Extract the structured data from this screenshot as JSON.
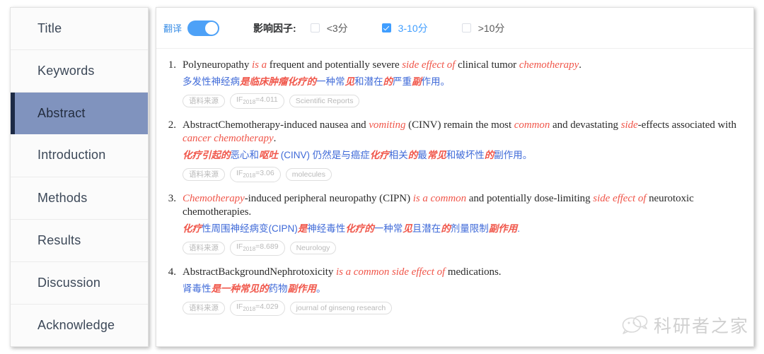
{
  "sidebar": {
    "items": [
      {
        "label": "Title",
        "active": false
      },
      {
        "label": "Keywords",
        "active": false
      },
      {
        "label": "Abstract",
        "active": true
      },
      {
        "label": "Introduction",
        "active": false
      },
      {
        "label": "Methods",
        "active": false
      },
      {
        "label": "Results",
        "active": false
      },
      {
        "label": "Discussion",
        "active": false
      },
      {
        "label": "Acknowledge",
        "active": false
      }
    ]
  },
  "toolbar": {
    "translate_label": "翻译",
    "translate_on": true,
    "impact_factor_label": "影响因子:",
    "filters": [
      {
        "label": "<3分",
        "checked": false
      },
      {
        "label": "3-10分",
        "checked": true
      },
      {
        "label": ">10分",
        "checked": false
      }
    ]
  },
  "results": [
    {
      "number": "1.",
      "en_parts": [
        {
          "t": "Polyneuropathy ",
          "hl": false
        },
        {
          "t": "is a",
          "hl": true
        },
        {
          "t": " frequent and potentially severe ",
          "hl": false
        },
        {
          "t": "side effect of",
          "hl": true
        },
        {
          "t": " clinical tumor ",
          "hl": false
        },
        {
          "t": "chemotherapy",
          "hl": true
        },
        {
          "t": ".",
          "hl": false
        }
      ],
      "cn_parts": [
        {
          "t": "多发性神经病",
          "hl": false
        },
        {
          "t": "是临床肿瘤化疗的",
          "hl": true
        },
        {
          "t": "一种常",
          "hl": false
        },
        {
          "t": "见",
          "hl": true
        },
        {
          "t": "和潜在",
          "hl": false
        },
        {
          "t": "的",
          "hl": true
        },
        {
          "t": "严重",
          "hl": false
        },
        {
          "t": "副",
          "hl": true
        },
        {
          "t": "作用",
          "hl": false
        },
        {
          "t": "。",
          "hl": false
        }
      ],
      "tags": [
        {
          "text": "语料来源"
        },
        {
          "text": "IF",
          "sub": "2018",
          "tail": "=4.011"
        },
        {
          "text": "Scientific Reports"
        }
      ]
    },
    {
      "number": "2.",
      "en_parts": [
        {
          "t": "AbstractChemotherapy-induced nausea and ",
          "hl": false
        },
        {
          "t": "vomiting",
          "hl": true
        },
        {
          "t": " (CINV) remain the most ",
          "hl": false
        },
        {
          "t": "common",
          "hl": true
        },
        {
          "t": " and devastating ",
          "hl": false
        },
        {
          "t": "side",
          "hl": true
        },
        {
          "t": "-effects associated with ",
          "hl": false
        },
        {
          "t": "cancer chemotherapy",
          "hl": true
        },
        {
          "t": ".",
          "hl": false
        }
      ],
      "cn_parts": [
        {
          "t": "化疗引起的",
          "hl": true
        },
        {
          "t": "恶心和",
          "hl": false
        },
        {
          "t": "呕吐",
          "hl": true
        },
        {
          "t": " (CINV) 仍然是与癌症",
          "hl": false
        },
        {
          "t": "化疗",
          "hl": true
        },
        {
          "t": "相关",
          "hl": false
        },
        {
          "t": "的",
          "hl": true
        },
        {
          "t": "最",
          "hl": false
        },
        {
          "t": "常见",
          "hl": true
        },
        {
          "t": "和破坏性",
          "hl": false
        },
        {
          "t": "的",
          "hl": true
        },
        {
          "t": "副作用",
          "hl": false
        },
        {
          "t": "。",
          "hl": false
        }
      ],
      "tags": [
        {
          "text": "语料来源"
        },
        {
          "text": "IF",
          "sub": "2018",
          "tail": "=3.06"
        },
        {
          "text": "molecules"
        }
      ]
    },
    {
      "number": "3.",
      "en_parts": [
        {
          "t": "Chemotherapy",
          "hl": true
        },
        {
          "t": "-induced peripheral neuropathy (CIPN) ",
          "hl": false
        },
        {
          "t": "is a common",
          "hl": true
        },
        {
          "t": " and potentially dose-limiting ",
          "hl": false
        },
        {
          "t": "side effect of",
          "hl": true
        },
        {
          "t": " neurotoxic chemotherapies.",
          "hl": false
        }
      ],
      "cn_parts": [
        {
          "t": "化疗",
          "hl": true
        },
        {
          "t": "性周围神经病变(CIPN)",
          "hl": false
        },
        {
          "t": "是",
          "hl": true
        },
        {
          "t": "神经毒性",
          "hl": false
        },
        {
          "t": "化疗的",
          "hl": true
        },
        {
          "t": "一种常",
          "hl": false
        },
        {
          "t": "见",
          "hl": true
        },
        {
          "t": "且潜在",
          "hl": false
        },
        {
          "t": "的",
          "hl": true
        },
        {
          "t": "剂量限制",
          "hl": false
        },
        {
          "t": "副作用",
          "hl": true
        },
        {
          "t": ".",
          "hl": false
        }
      ],
      "tags": [
        {
          "text": "语料来源"
        },
        {
          "text": "IF",
          "sub": "2018",
          "tail": "=8.689"
        },
        {
          "text": "Neurology"
        }
      ]
    },
    {
      "number": "4.",
      "en_parts": [
        {
          "t": "AbstractBackgroundNephrotoxicity ",
          "hl": false
        },
        {
          "t": "is a common side effect of",
          "hl": true
        },
        {
          "t": " medications.",
          "hl": false
        }
      ],
      "cn_parts": [
        {
          "t": "肾毒性",
          "hl": false
        },
        {
          "t": "是一种常见的",
          "hl": true
        },
        {
          "t": "药物",
          "hl": false
        },
        {
          "t": "副作用",
          "hl": true
        },
        {
          "t": "。",
          "hl": false
        }
      ],
      "tags": [
        {
          "text": "语料来源"
        },
        {
          "text": "IF",
          "sub": "2018",
          "tail": "=4.029"
        },
        {
          "text": "journal of ginseng research"
        }
      ]
    }
  ],
  "watermark": {
    "text": "科研者之家",
    "icon": "wechat-bubbles-icon"
  },
  "colors": {
    "accent_blue": "#409eff",
    "highlight_red": "#f0564a",
    "translation_blue": "#3f6ad8",
    "sidebar_active_bg": "#8093be",
    "sidebar_active_bar": "#1d2a45"
  }
}
